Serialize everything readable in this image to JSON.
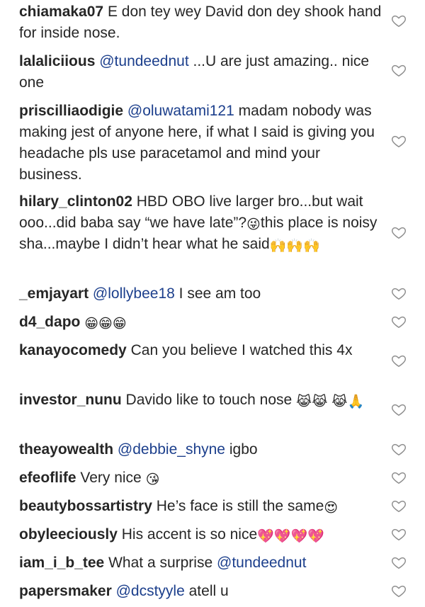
{
  "comments": [
    {
      "user": "chiamaka07",
      "text": "E don tey wey David don dey shook hand for inside nose."
    },
    {
      "user": "lalaliciious",
      "mention": "@tundeednut",
      "text": "...U are just amazing.. nice one"
    },
    {
      "user": "priscilliaodigie",
      "mention": "@oluwatami121",
      "text": "madam nobody was making jest of anyone here, if what I said is giving you headache pls use paracetamol and mind your business."
    },
    {
      "user": "hilary_clinton02",
      "text": "HBD OBO live larger bro...but wait ooo...did baba say “we have late”?",
      "emoji1": "😜",
      "text2": "this place is noisy sha...maybe I didn’t hear what he said",
      "emoji2": "🙌🙌🙌"
    },
    {
      "user": "_emjayart",
      "mention": "@lollybee18",
      "text": "I see am too"
    },
    {
      "user": "d4_dapo",
      "emoji1": "😁😁😁"
    },
    {
      "user": "kanayocomedy",
      "text": "Can you believe I watched this 4x"
    },
    {
      "user": "investor_nunu",
      "text": "Davido like to touch nose",
      "emoji1": "😹😹",
      "emoji2": "😹🙏"
    },
    {
      "user": "theayowealth",
      "mention": "@debbie_shyne",
      "text": "igbo"
    },
    {
      "user": "efeoflife",
      "text": "Very nice",
      "emoji1": "😘"
    },
    {
      "user": "beautybossartistry",
      "text": "He’s face is still the same",
      "emoji1": "😍"
    },
    {
      "user": "obyleeciously",
      "text": "His accent is so nice",
      "emoji1": "💖💖💖💖"
    },
    {
      "user": "iam_i_b_tee",
      "text": "What a surprise",
      "mention_after": "@tundeednut"
    },
    {
      "user": "papersmaker",
      "mention": "@dcstyyle",
      "text": "atell u"
    }
  ],
  "icons": {
    "like": "heart-outline-icon"
  },
  "colors": {
    "text": "#262626",
    "mention": "#1c3f8c",
    "heart": "#8e8e8e",
    "username": "#262626"
  }
}
